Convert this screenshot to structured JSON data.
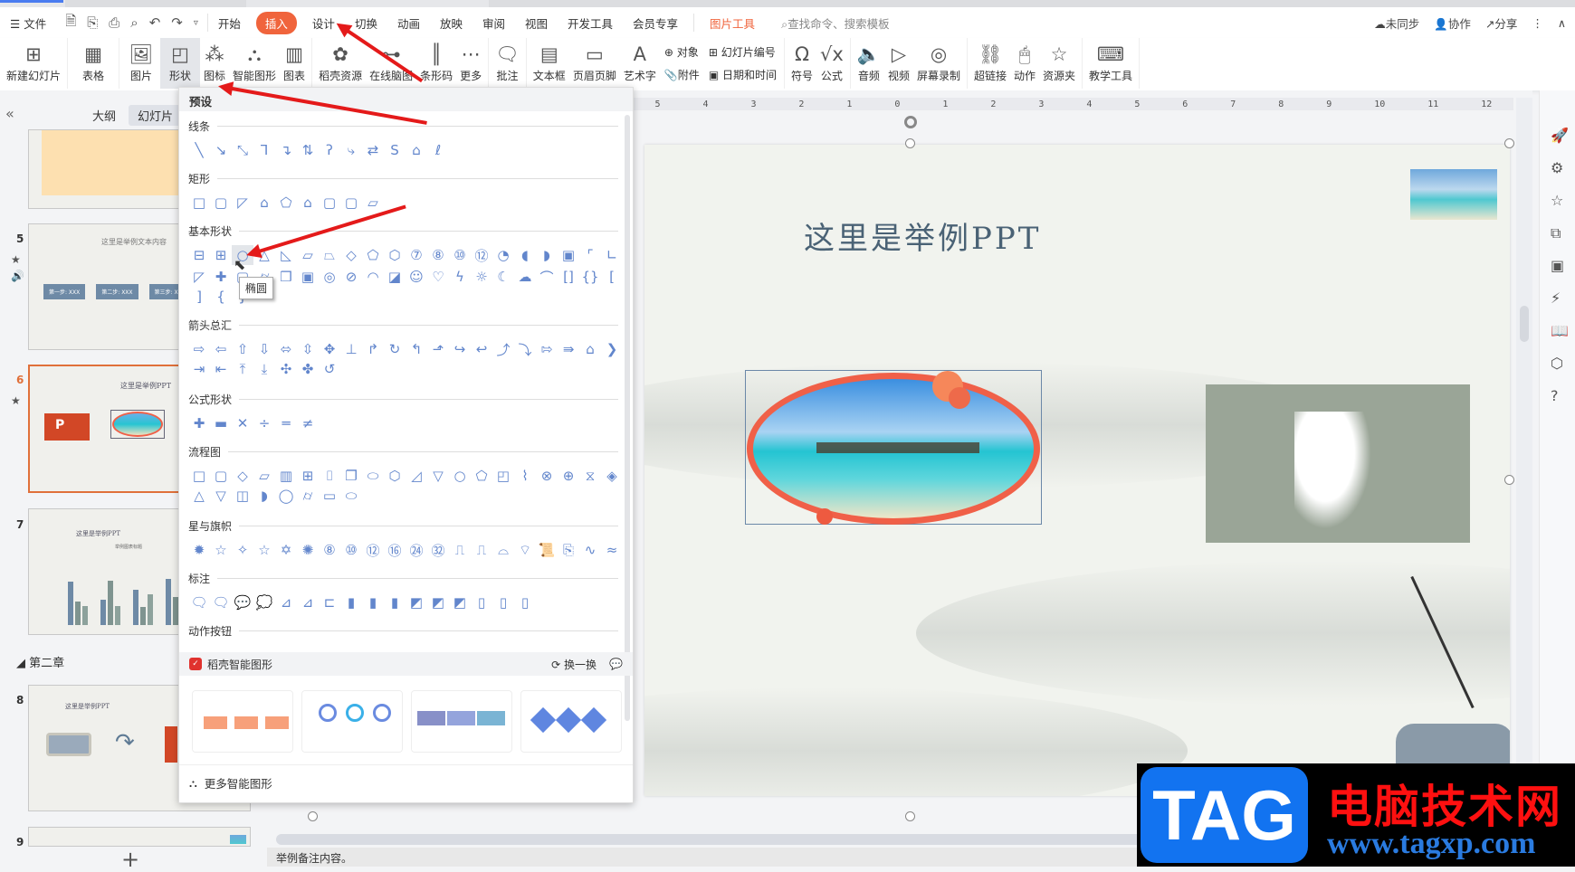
{
  "menubar": {
    "file_label": "文件",
    "tabs": [
      "开始",
      "插入",
      "设计",
      "切换",
      "动画",
      "放映",
      "审阅",
      "视图",
      "开发工具",
      "会员专享"
    ],
    "active_tab": "插入",
    "picture_tools": "图片工具",
    "search_placeholder": "查找命令、搜索模板",
    "sync": "未同步",
    "collab": "协作",
    "share": "分享"
  },
  "ribbon": {
    "new_slide": "新建幻灯片",
    "table": "表格",
    "picture": "图片",
    "shapes": "形状",
    "icons": "图标",
    "smart_art": "智能图形",
    "chart": "图表",
    "docer_resources": "稻壳资源",
    "mind_map": "在线脑图",
    "barcode": "条形码",
    "more": "更多",
    "comment": "批注",
    "textbox": "文本框",
    "header_footer": "页眉页脚",
    "wordart": "艺术字",
    "object": "对象",
    "attachment": "附件",
    "slide_number": "幻灯片编号",
    "date_time": "日期和时间",
    "symbol": "符号",
    "formula": "公式",
    "audio": "音频",
    "video": "视频",
    "screen_record": "屏幕录制",
    "hyperlink": "超链接",
    "action": "动作",
    "resource_folder": "资源夹",
    "teaching_tools": "教学工具"
  },
  "left_panel": {
    "tab_outline": "大纲",
    "tab_slides": "幻灯片",
    "section2": "第二章",
    "slides": [
      {
        "num": "5",
        "title": "这里是举例文本内容",
        "steps": [
          "第一步: XXX",
          "第二步: XXX",
          "第三步: XXX"
        ]
      },
      {
        "num": "6",
        "title": "这里是举例PPT",
        "selected": true
      },
      {
        "num": "7",
        "title": "这里是举例PPT",
        "chart_title": "举例图表标题"
      },
      {
        "num": "8",
        "title": "这里是举例PPT"
      },
      {
        "num": "9"
      }
    ]
  },
  "shapes_dropdown": {
    "header": "预设",
    "categories": [
      "线条",
      "矩形",
      "基本形状",
      "箭头总汇",
      "公式形状",
      "流程图",
      "星与旗帜",
      "标注",
      "动作按钮"
    ],
    "tooltip": "椭圆",
    "smart_bar_title": "稻壳智能图形",
    "refresh": "换一换",
    "more_smart": "更多智能图形"
  },
  "slide": {
    "title": "这里是举例PPT"
  },
  "ruler": [
    "5",
    "4",
    "3",
    "2",
    "1",
    "0",
    "1",
    "2",
    "3",
    "4",
    "5",
    "6",
    "7",
    "8",
    "9",
    "10",
    "11",
    "12"
  ],
  "notes": "举例备注内容。",
  "watermark": {
    "tag": "TAG",
    "cn": "电脑技术网",
    "url": "www.tagxp.com"
  },
  "colors": {
    "accent": "#f0643c",
    "shape_icon": "#6286cc",
    "selected_slide_border": "#e0703a",
    "ellipse_border": "#f06048"
  }
}
